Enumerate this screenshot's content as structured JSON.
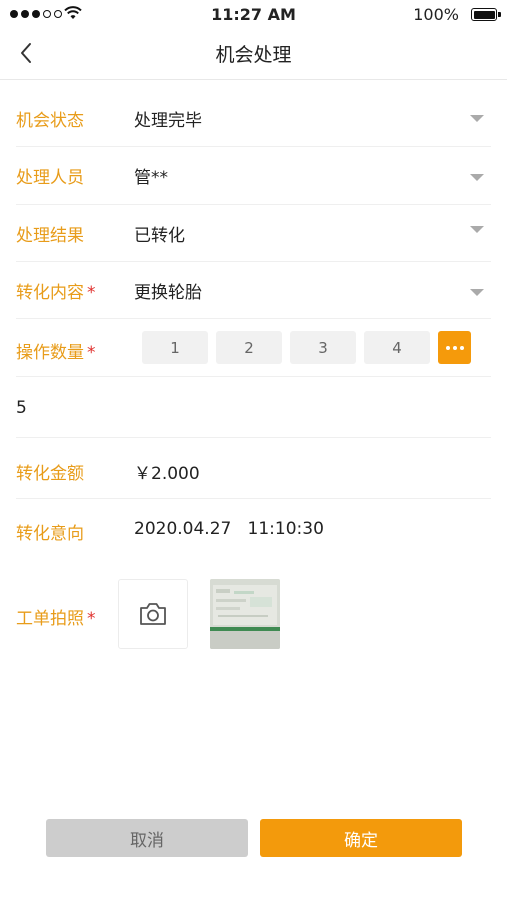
{
  "status_bar": {
    "time": "11:27 AM",
    "battery": "100%"
  },
  "nav": {
    "title": "机会处理"
  },
  "form": {
    "status": {
      "label": "机会状态",
      "value": "处理完毕"
    },
    "handler": {
      "label": "处理人员",
      "value": "管**"
    },
    "result": {
      "label": "处理结果",
      "value": "已转化"
    },
    "content": {
      "label": "转化内容",
      "value": "更换轮胎",
      "required": "*"
    },
    "quantity": {
      "label": "操作数量",
      "required": "*",
      "options": [
        "1",
        "2",
        "3",
        "4"
      ],
      "input_value": "5"
    },
    "amount": {
      "label": "转化金额",
      "value": "￥2.000"
    },
    "intent": {
      "label": "转化意向",
      "value": "2020.04.27   11:10:30"
    },
    "photo": {
      "label": "工单拍照",
      "required": "*"
    }
  },
  "buttons": {
    "cancel": "取消",
    "confirm": "确定"
  },
  "colors": {
    "accent": "#f39a0c",
    "label": "#e89c1a",
    "required": "#e0322f"
  }
}
